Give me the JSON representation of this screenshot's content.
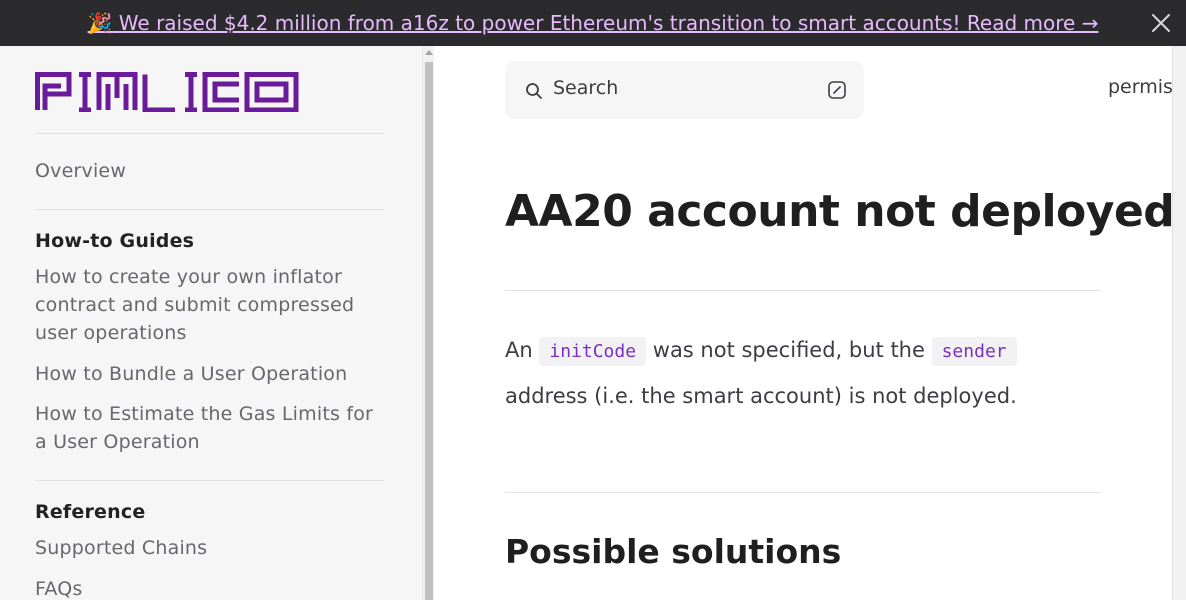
{
  "banner": {
    "emoji": "🎉",
    "text": "We raised $4.2 million from a16z to power Ethereum's transition to smart accounts! Read more →"
  },
  "logo": {
    "text": "PIMLICO",
    "color": "#6a1b9a"
  },
  "sidebar": {
    "overview": "Overview",
    "sections": [
      {
        "heading": "How-to Guides",
        "items": [
          "How to create your own inflator contract and submit compressed user operations",
          "How to Bundle a User Operation",
          "How to Estimate the Gas Limits for a User Operation"
        ]
      },
      {
        "heading": "Reference",
        "items": [
          "Supported Chains",
          "FAQs"
        ]
      }
    ]
  },
  "header": {
    "search_placeholder": "Search",
    "top_right_text": "permis"
  },
  "article": {
    "title": "AA20 account not deployed",
    "para_prefix": "An",
    "code1": "initCode",
    "para_mid": "was not specified, but the",
    "code2": "sender",
    "para_suffix": "address (i.e. the smart account) is not deployed.",
    "section_heading": "Possible solutions"
  },
  "colors": {
    "banner_bg": "#2b2b2e",
    "banner_link": "#e8b9ff",
    "brand_purple": "#6a1b9a",
    "code_text": "#7b2fbf",
    "sidebar_bg": "#f6f6f7"
  }
}
